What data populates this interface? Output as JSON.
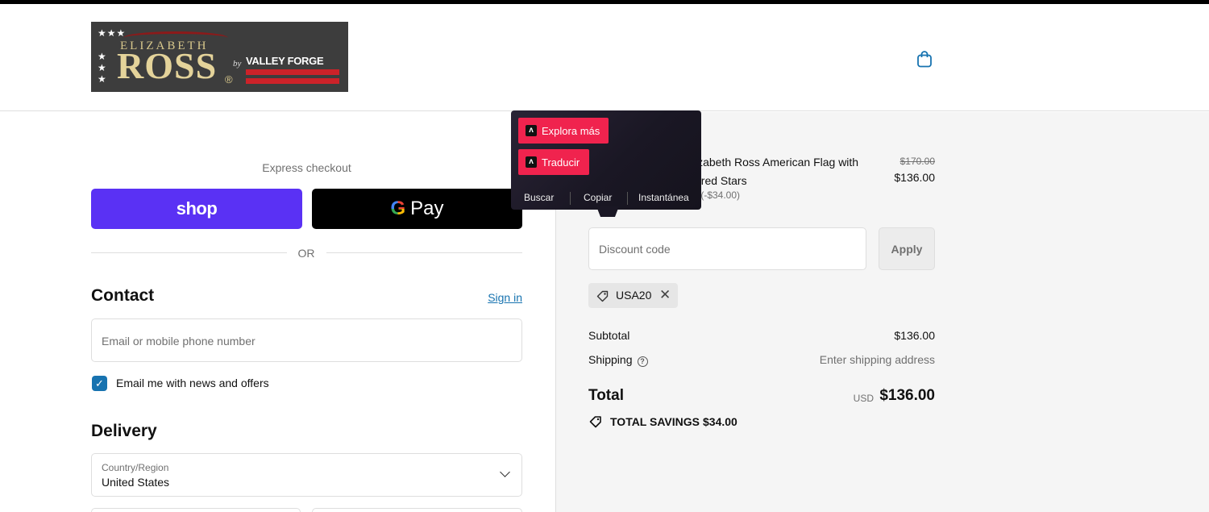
{
  "header": {
    "logo": {
      "brand_line1": "ELIZABETH",
      "brand_line2": "ROSS",
      "registered": "®",
      "by": "by",
      "partner": "VALLEY FORGE"
    },
    "cart_icon": "shopping-bag-icon"
  },
  "express": {
    "label": "Express checkout",
    "shop_label": "shop",
    "gpay_label": "Pay",
    "or_label": "OR"
  },
  "contact": {
    "heading": "Contact",
    "sign_in": "Sign in",
    "email_placeholder": "Email or mobile phone number",
    "newsletter_label": "Email me with news and offers",
    "newsletter_checked": true
  },
  "delivery": {
    "heading": "Delivery",
    "country_label": "Country/Region",
    "country_value": "United States"
  },
  "summary": {
    "product_title_visible": "izabeth Ross American Flag with ered Stars",
    "product_discount_visible": ") (-$34.00)",
    "price_original": "$170.00",
    "price_current": "$136.00",
    "discount_placeholder": "Discount code",
    "apply_label": "Apply",
    "applied_code": "USA20",
    "subtotal_label": "Subtotal",
    "subtotal_value": "$136.00",
    "shipping_label": "Shipping",
    "shipping_value": "Enter shipping address",
    "total_label": "Total",
    "currency": "USD",
    "total_value": "$136.00",
    "savings_label": "TOTAL SAVINGS",
    "savings_value": "$34.00"
  },
  "popup": {
    "explore": "Explora más",
    "translate": "Traducir",
    "actions": [
      "Buscar",
      "Copiar",
      "Instantánea"
    ]
  },
  "colors": {
    "shop_purple": "#5a31f4",
    "link_blue": "#1773b0",
    "popup_accent": "#f0234e"
  }
}
